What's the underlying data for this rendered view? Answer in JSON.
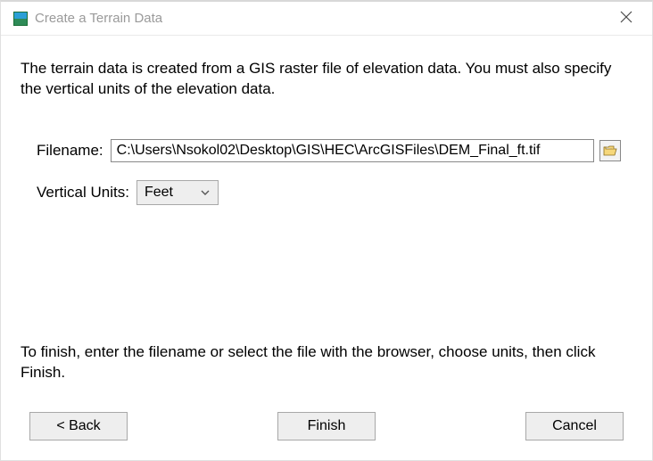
{
  "titlebar": {
    "title": "Create a Terrain Data"
  },
  "main": {
    "instruction": "The terrain data is created from a GIS raster file of elevation data. You must also specify the vertical units of the elevation data.",
    "filename_label": "Filename:",
    "filename_value": "C:\\Users\\Nsokol02\\Desktop\\GIS\\HEC\\ArcGISFiles\\DEM_Final_ft.tif",
    "units_label": "Vertical Units:",
    "units_value": "Feet",
    "hint": "To finish, enter the filename or select the file with the browser, choose units, then click Finish."
  },
  "buttons": {
    "back": "< Back",
    "finish": "Finish",
    "cancel": "Cancel"
  }
}
